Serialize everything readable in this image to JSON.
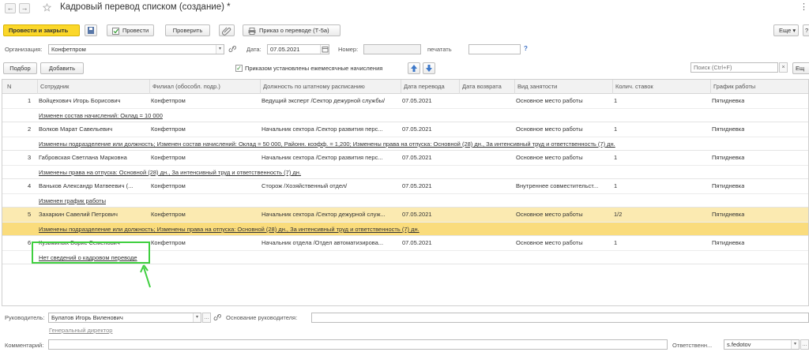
{
  "window": {
    "back_glyph": "←",
    "forward_glyph": "→",
    "title": "Кадровый перевод списком (создание) *",
    "more_glyph": "⋮"
  },
  "toolbar": {
    "post_and_close": "Провести и закрыть",
    "post": "Провести",
    "check": "Проверить",
    "order_print": "Приказ о переводе (Т-5а)",
    "more": "Еще",
    "more_arrow": "▾",
    "help": "?"
  },
  "header_fields": {
    "org_label": "Организация:",
    "org_value": "Конфетпром",
    "date_label": "Дата:",
    "date_value": "07.05.2021",
    "number_label": "Номер:",
    "number_value": "",
    "print_label": "печатать",
    "print_value": "",
    "help": "?"
  },
  "list_toolbar": {
    "select": "Подбор",
    "add": "Добавить",
    "monthly_checkbox_label": "Приказом установлены ежемесячные начисления",
    "monthly_checked": true,
    "search_placeholder": "Поиск (Ctrl+F)",
    "clear": "×",
    "more": "Ещ"
  },
  "table": {
    "headers": [
      "N",
      "Сотрудник",
      "Филиал (обособл. подр.)",
      "Должность по штатному расписанию",
      "Дата перевода",
      "Дата возврата",
      "Вид занятости",
      "Колич. ставок",
      "График работы"
    ],
    "rows": [
      {
        "n": "1",
        "employee": "Войцехович Игорь Борисович",
        "branch": "Конфетпром",
        "position": "Ведущий эксперт /Сектор дежурной службы/",
        "transfer_date": "07.05.2021",
        "return_date": "",
        "employment": "Основное место работы",
        "rates": "1",
        "schedule": "Пятидневка",
        "changes": "Изменен состав начислений: Оклад = 10 000"
      },
      {
        "n": "2",
        "employee": "Волков Марат Савельевич",
        "branch": "Конфетпром",
        "position": "Начальник сектора /Сектор развития перс...",
        "transfer_date": "07.05.2021",
        "return_date": "",
        "employment": "Основное место работы",
        "rates": "1",
        "schedule": "Пятидневка",
        "changes": "Изменены подразделение или должность; Изменен состав начислений: Оклад = 50 000, Районн. коэфф. = 1,200; Изменены права на отпуска: Основной (28) дн., За интенсивный труд и ответственность (7) дн."
      },
      {
        "n": "3",
        "employee": "Габровская Светлана Марковна",
        "branch": "Конфетпром",
        "position": "Начальник сектора /Сектор развития перс...",
        "transfer_date": "07.05.2021",
        "return_date": "",
        "employment": "Основное место работы",
        "rates": "1",
        "schedule": "Пятидневка",
        "changes": "Изменены права на отпуска: Основной (28) дн., За интенсивный труд и ответственность (7) дн."
      },
      {
        "n": "4",
        "employee": "Ваньков Александр Матвеевич (...",
        "branch": "Конфетпром",
        "position": "Сторож /Хозяйственный отдел/",
        "transfer_date": "07.05.2021",
        "return_date": "",
        "employment": "Внутреннее совместительст...",
        "rates": "1",
        "schedule": "Пятидневка",
        "changes": "Изменен график работы"
      },
      {
        "n": "5",
        "employee": "Захаркин Савелий Петрович",
        "branch": "Конфетпром",
        "position": "Начальник сектора /Сектор дежурной служ...",
        "transfer_date": "07.05.2021",
        "return_date": "",
        "employment": "Основное место работы",
        "rates": "1/2",
        "schedule": "Пятидневка",
        "changes": "Изменены подразделение или должность; Изменены права на отпуска: Основной (28) дн., За интенсивный труд и ответственность (7) дн."
      },
      {
        "n": "6",
        "employee": "Кузьминых Борис Семенович",
        "branch": "Конфетпром",
        "position": "Начальник отдела /Отдел автоматизирова...",
        "transfer_date": "07.05.2021",
        "return_date": "",
        "employment": "Основное место работы",
        "rates": "1",
        "schedule": "Пятидневка",
        "changes": "Нет сведений о кадровом переводе"
      }
    ]
  },
  "footer": {
    "manager_label": "Руководитель:",
    "manager_value": "Булатов Игорь Виленович",
    "manager_position": "Генеральный директор",
    "basis_label": "Основание руководителя:",
    "basis_value": "",
    "comment_label": "Комментарий:",
    "comment_value": "",
    "responsible_label": "Ответственн...",
    "responsible_value": "s.fedotov"
  },
  "colors": {
    "primary_button": "#fbd72a",
    "selected_row": "#fbeab1",
    "highlight": "#3fcf3f"
  }
}
